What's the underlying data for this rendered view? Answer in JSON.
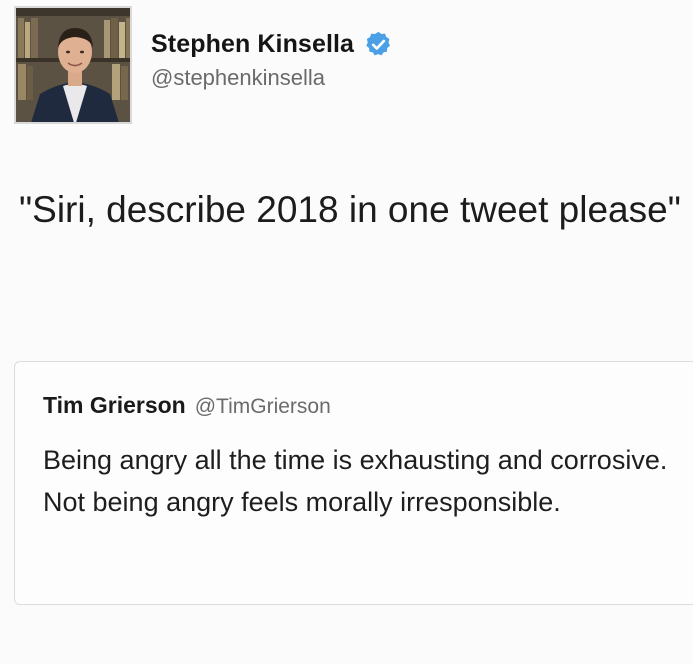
{
  "author": {
    "name": "Stephen Kinsella",
    "handle": "@stephenkinsella",
    "verified_icon": "verified-badge-icon",
    "avatar": "profile-photo"
  },
  "tweet": {
    "text": "\"Siri, describe 2018 in one tweet please\""
  },
  "quoted_tweet": {
    "name": "Tim Grierson",
    "handle": "@TimGrierson",
    "text": "Being angry all the time is exhausting and corrosive. Not being angry feels morally irresponsible."
  },
  "colors": {
    "background": "#fbfbfb",
    "verified_blue": "#4a9fe6",
    "handle_gray": "#6a6a6a",
    "quote_border": "#dcdcdc"
  }
}
